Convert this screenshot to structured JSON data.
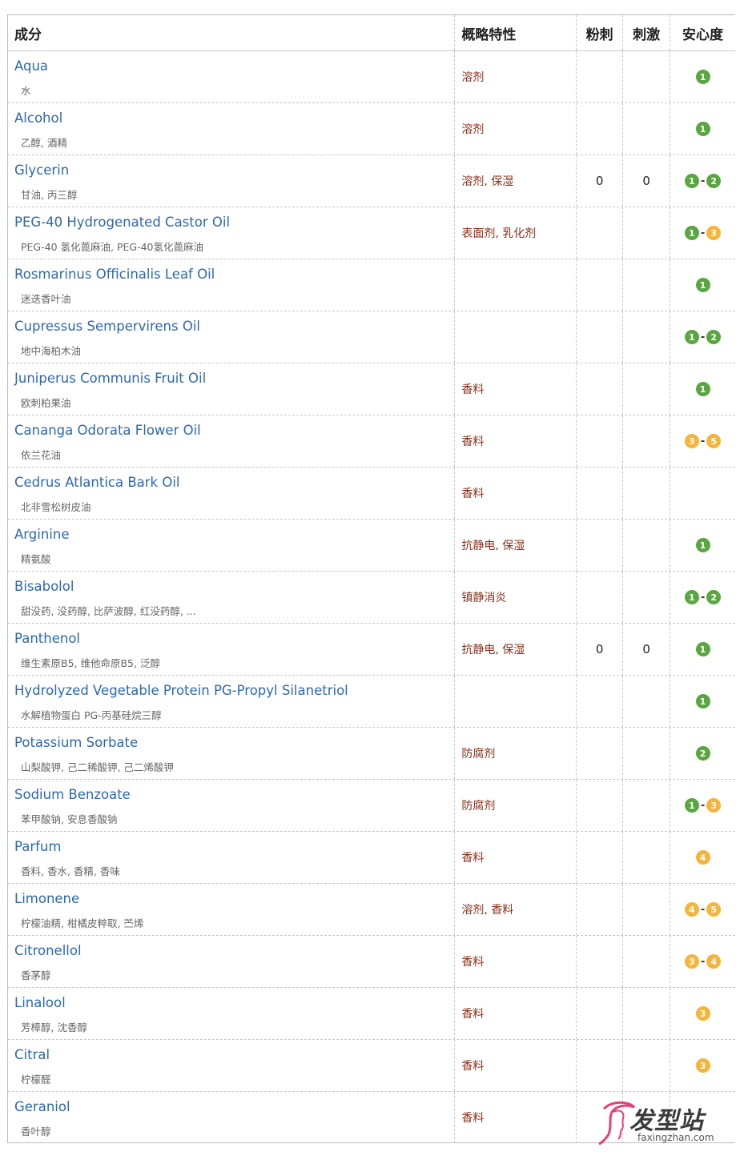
{
  "colors": {
    "green": "#5aa641",
    "yellow": "#f6b53a",
    "link": "#2c68b3",
    "feature": "#8b2e18"
  },
  "headers": {
    "name": "成分",
    "feature": "概略特性",
    "acne": "粉刺",
    "irritation": "刺激",
    "safety": "安心度"
  },
  "rows": [
    {
      "name": "Aqua",
      "alias": "水",
      "feature": "溶剂",
      "acne": "",
      "irritation": "",
      "safety": [
        "1"
      ]
    },
    {
      "name": "Alcohol",
      "alias": "乙醇, 酒精",
      "feature": "溶剂",
      "acne": "",
      "irritation": "",
      "safety": [
        "1"
      ]
    },
    {
      "name": "Glycerin",
      "alias": "甘油, 丙三醇",
      "feature": "溶剂, 保湿",
      "acne": "0",
      "irritation": "0",
      "safety": [
        "1",
        "2"
      ]
    },
    {
      "name": "PEG-40 Hydrogenated Castor Oil",
      "alias": "PEG-40 氢化蓖麻油, PEG-40氢化蓖麻油",
      "feature": "表面剂, 乳化剂",
      "acne": "",
      "irritation": "",
      "safety": [
        "1",
        "3"
      ]
    },
    {
      "name": "Rosmarinus Officinalis Leaf Oil",
      "alias": "迷迭香叶油",
      "feature": "",
      "acne": "",
      "irritation": "",
      "safety": [
        "1"
      ]
    },
    {
      "name": "Cupressus Sempervirens Oil",
      "alias": "地中海柏木油",
      "feature": "",
      "acne": "",
      "irritation": "",
      "safety": [
        "1",
        "2"
      ]
    },
    {
      "name": "Juniperus Communis Fruit Oil",
      "alias": "欧刺柏果油",
      "feature": "香料",
      "acne": "",
      "irritation": "",
      "safety": [
        "1"
      ]
    },
    {
      "name": "Cananga Odorata Flower Oil",
      "alias": "依兰花油",
      "feature": "香料",
      "acne": "",
      "irritation": "",
      "safety": [
        "3",
        "5"
      ]
    },
    {
      "name": "Cedrus Atlantica Bark Oil",
      "alias": "北非雪松树皮油",
      "feature": "香料",
      "acne": "",
      "irritation": "",
      "safety": []
    },
    {
      "name": "Arginine",
      "alias": "精氨酸",
      "feature": "抗静电, 保湿",
      "acne": "",
      "irritation": "",
      "safety": [
        "1"
      ]
    },
    {
      "name": "Bisabolol",
      "alias": "甜没药, 没药醇, 比萨波醇, 红没药醇, ...",
      "feature": "镇静消炎",
      "acne": "",
      "irritation": "",
      "safety": [
        "1",
        "2"
      ]
    },
    {
      "name": "Panthenol",
      "alias": "维生素原B5, 维他命原B5, 泛醇",
      "feature": "抗静电, 保湿",
      "acne": "0",
      "irritation": "0",
      "safety": [
        "1"
      ]
    },
    {
      "name": "Hydrolyzed Vegetable Protein PG-Propyl Silanetriol",
      "alias": "水解植物蛋白 PG-丙基硅烷三醇",
      "feature": "",
      "acne": "",
      "irritation": "",
      "safety": [
        "1"
      ]
    },
    {
      "name": "Potassium Sorbate",
      "alias": "山梨酸钾, 己二稀酸钾, 己二烯酸钾",
      "feature": "防腐剂",
      "acne": "",
      "irritation": "",
      "safety": [
        "2"
      ]
    },
    {
      "name": "Sodium Benzoate",
      "alias": "苯甲酸钠, 安息香酸钠",
      "feature": "防腐剂",
      "acne": "",
      "irritation": "",
      "safety": [
        "1",
        "3"
      ]
    },
    {
      "name": "Parfum",
      "alias": "香料, 香水, 香精, 香味",
      "feature": "香料",
      "acne": "",
      "irritation": "",
      "safety": [
        "4"
      ]
    },
    {
      "name": "Limonene",
      "alias": "柠檬油精, 柑橘皮粹取, 苎烯",
      "feature": "溶剂, 香料",
      "acne": "",
      "irritation": "",
      "safety": [
        "4",
        "5"
      ]
    },
    {
      "name": "Citronellol",
      "alias": "香茅醇",
      "feature": "香料",
      "acne": "",
      "irritation": "",
      "safety": [
        "3",
        "4"
      ]
    },
    {
      "name": "Linalool",
      "alias": "芳樟醇, 沈香醇",
      "feature": "香料",
      "acne": "",
      "irritation": "",
      "safety": [
        "3"
      ]
    },
    {
      "name": "Citral",
      "alias": "柠檬醛",
      "feature": "香料",
      "acne": "",
      "irritation": "",
      "safety": [
        "3"
      ]
    },
    {
      "name": "Geraniol",
      "alias": "香叶醇",
      "feature": "香料",
      "acne": "",
      "irritation": "",
      "safety": []
    }
  ],
  "watermark": {
    "logo_text": "发型站",
    "url": "faxingzhan.com"
  }
}
